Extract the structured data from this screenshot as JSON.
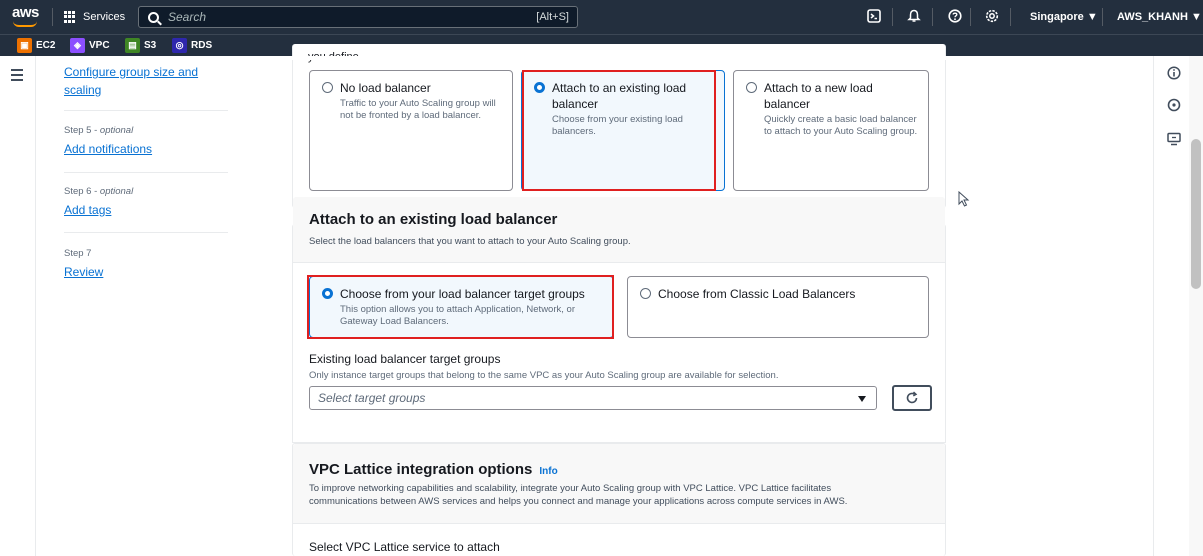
{
  "topnav": {
    "logo": "aws",
    "services_label": "Services",
    "search_placeholder": "Search",
    "search_shortcut": "[Alt+S]",
    "region": "Singapore ▼",
    "account": "AWS_KHANH ▼"
  },
  "favorites": [
    {
      "label": "EC2",
      "color": "#ed7100"
    },
    {
      "label": "VPC",
      "color": "#8c4fff"
    },
    {
      "label": "S3",
      "color": "#3f8624"
    },
    {
      "label": "RDS",
      "color": "#2e27ad"
    }
  ],
  "steps": {
    "step4_link_line1": "Configure group size and",
    "step4_link_line2": "scaling",
    "step5_label": "Step 5 - ",
    "step5_optional": "optional",
    "step5_link": "Add notifications",
    "step6_label": "Step 6 - ",
    "step6_optional": "optional",
    "step6_link": "Add tags",
    "step7_label": "Step 7",
    "step7_link": "Review"
  },
  "load_balancing": {
    "cut_off_text": "you define.",
    "options": [
      {
        "title": "No load balancer",
        "desc": "Traffic to your Auto Scaling group will not be fronted by a load balancer.",
        "selected": false
      },
      {
        "title": "Attach to an existing load balancer",
        "desc": "Choose from your existing load balancers.",
        "selected": true
      },
      {
        "title": "Attach to a new load balancer",
        "desc": "Quickly create a basic load balancer to attach to your Auto Scaling group.",
        "selected": false
      }
    ]
  },
  "existing_lb": {
    "title": "Attach to an existing load balancer",
    "desc": "Select the load balancers that you want to attach to your Auto Scaling group.",
    "options": [
      {
        "title": "Choose from your load balancer target groups",
        "desc": "This option allows you to attach Application, Network, or Gateway Load Balancers.",
        "selected": true
      },
      {
        "title": "Choose from Classic Load Balancers",
        "desc": "",
        "selected": false
      }
    ],
    "field_label": "Existing load balancer target groups",
    "field_desc": "Only instance target groups that belong to the same VPC as your Auto Scaling group are available for selection.",
    "select_placeholder": "Select target groups"
  },
  "vpc_lattice": {
    "title": "VPC Lattice integration options",
    "info": "Info",
    "desc_line1": "To improve networking capabilities and scalability, integrate your Auto Scaling group with VPC Lattice. VPC Lattice facilitates",
    "desc_line2": "communications between AWS services and helps you connect and manage your applications across compute services in AWS.",
    "field_label": "Select VPC Lattice service to attach"
  }
}
